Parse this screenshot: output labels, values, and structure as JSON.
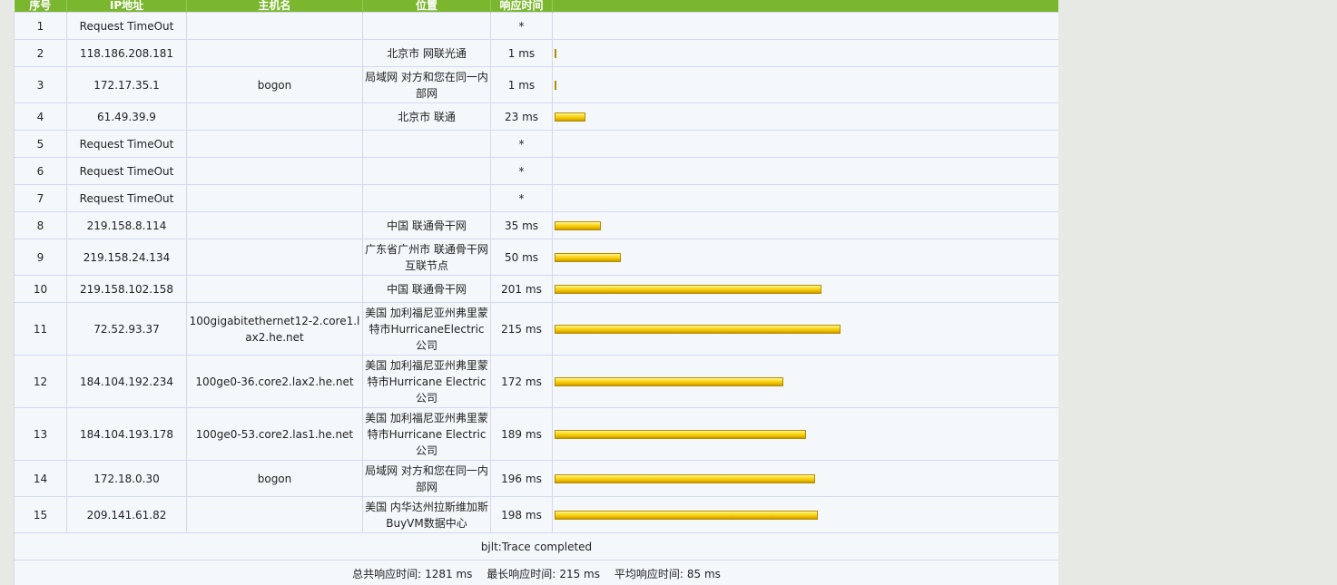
{
  "table": {
    "headers": [
      "序号",
      "IP地址",
      "主机名",
      "位置",
      "响应时间",
      ""
    ],
    "rows": [
      {
        "no": "1",
        "ip": "Request TimeOut",
        "host": "",
        "loc": "",
        "time": "*",
        "ms": 0
      },
      {
        "no": "2",
        "ip": "118.186.208.181",
        "host": "",
        "loc": "北京市 网联光通",
        "time": "1 ms",
        "ms": 1
      },
      {
        "no": "3",
        "ip": "172.17.35.1",
        "host": "bogon",
        "loc": "局域网 对方和您在同一内部网",
        "time": "1 ms",
        "ms": 1
      },
      {
        "no": "4",
        "ip": "61.49.39.9",
        "host": "",
        "loc": "北京市 联通",
        "time": "23 ms",
        "ms": 23
      },
      {
        "no": "5",
        "ip": "Request TimeOut",
        "host": "",
        "loc": "",
        "time": "*",
        "ms": 0
      },
      {
        "no": "6",
        "ip": "Request TimeOut",
        "host": "",
        "loc": "",
        "time": "*",
        "ms": 0
      },
      {
        "no": "7",
        "ip": "Request TimeOut",
        "host": "",
        "loc": "",
        "time": "*",
        "ms": 0
      },
      {
        "no": "8",
        "ip": "219.158.8.114",
        "host": "",
        "loc": "中国 联通骨干网",
        "time": "35 ms",
        "ms": 35
      },
      {
        "no": "9",
        "ip": "219.158.24.134",
        "host": "",
        "loc": "广东省广州市 联通骨干网互联节点",
        "time": "50 ms",
        "ms": 50
      },
      {
        "no": "10",
        "ip": "219.158.102.158",
        "host": "",
        "loc": "中国 联通骨干网",
        "time": "201 ms",
        "ms": 201
      },
      {
        "no": "11",
        "ip": "72.52.93.37",
        "host": "100gigabitethernet12-2.core1.lax2.he.net",
        "loc": "美国 加利福尼亚州弗里蒙特市HurricaneElectric公司",
        "time": "215 ms",
        "ms": 215
      },
      {
        "no": "12",
        "ip": "184.104.192.234",
        "host": "100ge0-36.core2.lax2.he.net",
        "loc": "美国 加利福尼亚州弗里蒙特市Hurricane Electric公司",
        "time": "172 ms",
        "ms": 172
      },
      {
        "no": "13",
        "ip": "184.104.193.178",
        "host": "100ge0-53.core2.las1.he.net",
        "loc": "美国 加利福尼亚州弗里蒙特市Hurricane Electric公司",
        "time": "189 ms",
        "ms": 189
      },
      {
        "no": "14",
        "ip": "172.18.0.30",
        "host": "bogon",
        "loc": "局域网 对方和您在同一内部网",
        "time": "196 ms",
        "ms": 196
      },
      {
        "no": "15",
        "ip": "209.141.61.82",
        "host": "",
        "loc": "美国 内华达州拉斯维加斯BuyVM数据中心",
        "time": "198 ms",
        "ms": 198
      }
    ],
    "max_ms": 215
  },
  "footer": {
    "status": "bjlt:Trace completed",
    "total_label": "总共响应时间:",
    "total_value": "1281 ms",
    "max_label": "最长响应时间:",
    "max_value": "215 ms",
    "avg_label": "平均响应时间:",
    "avg_value": "85 ms"
  },
  "colors": {
    "header_bg": "#7ab72f",
    "bar": "#f2c400",
    "cell_border": "#d3d9ee",
    "table_bg": "#f4f8fb"
  }
}
